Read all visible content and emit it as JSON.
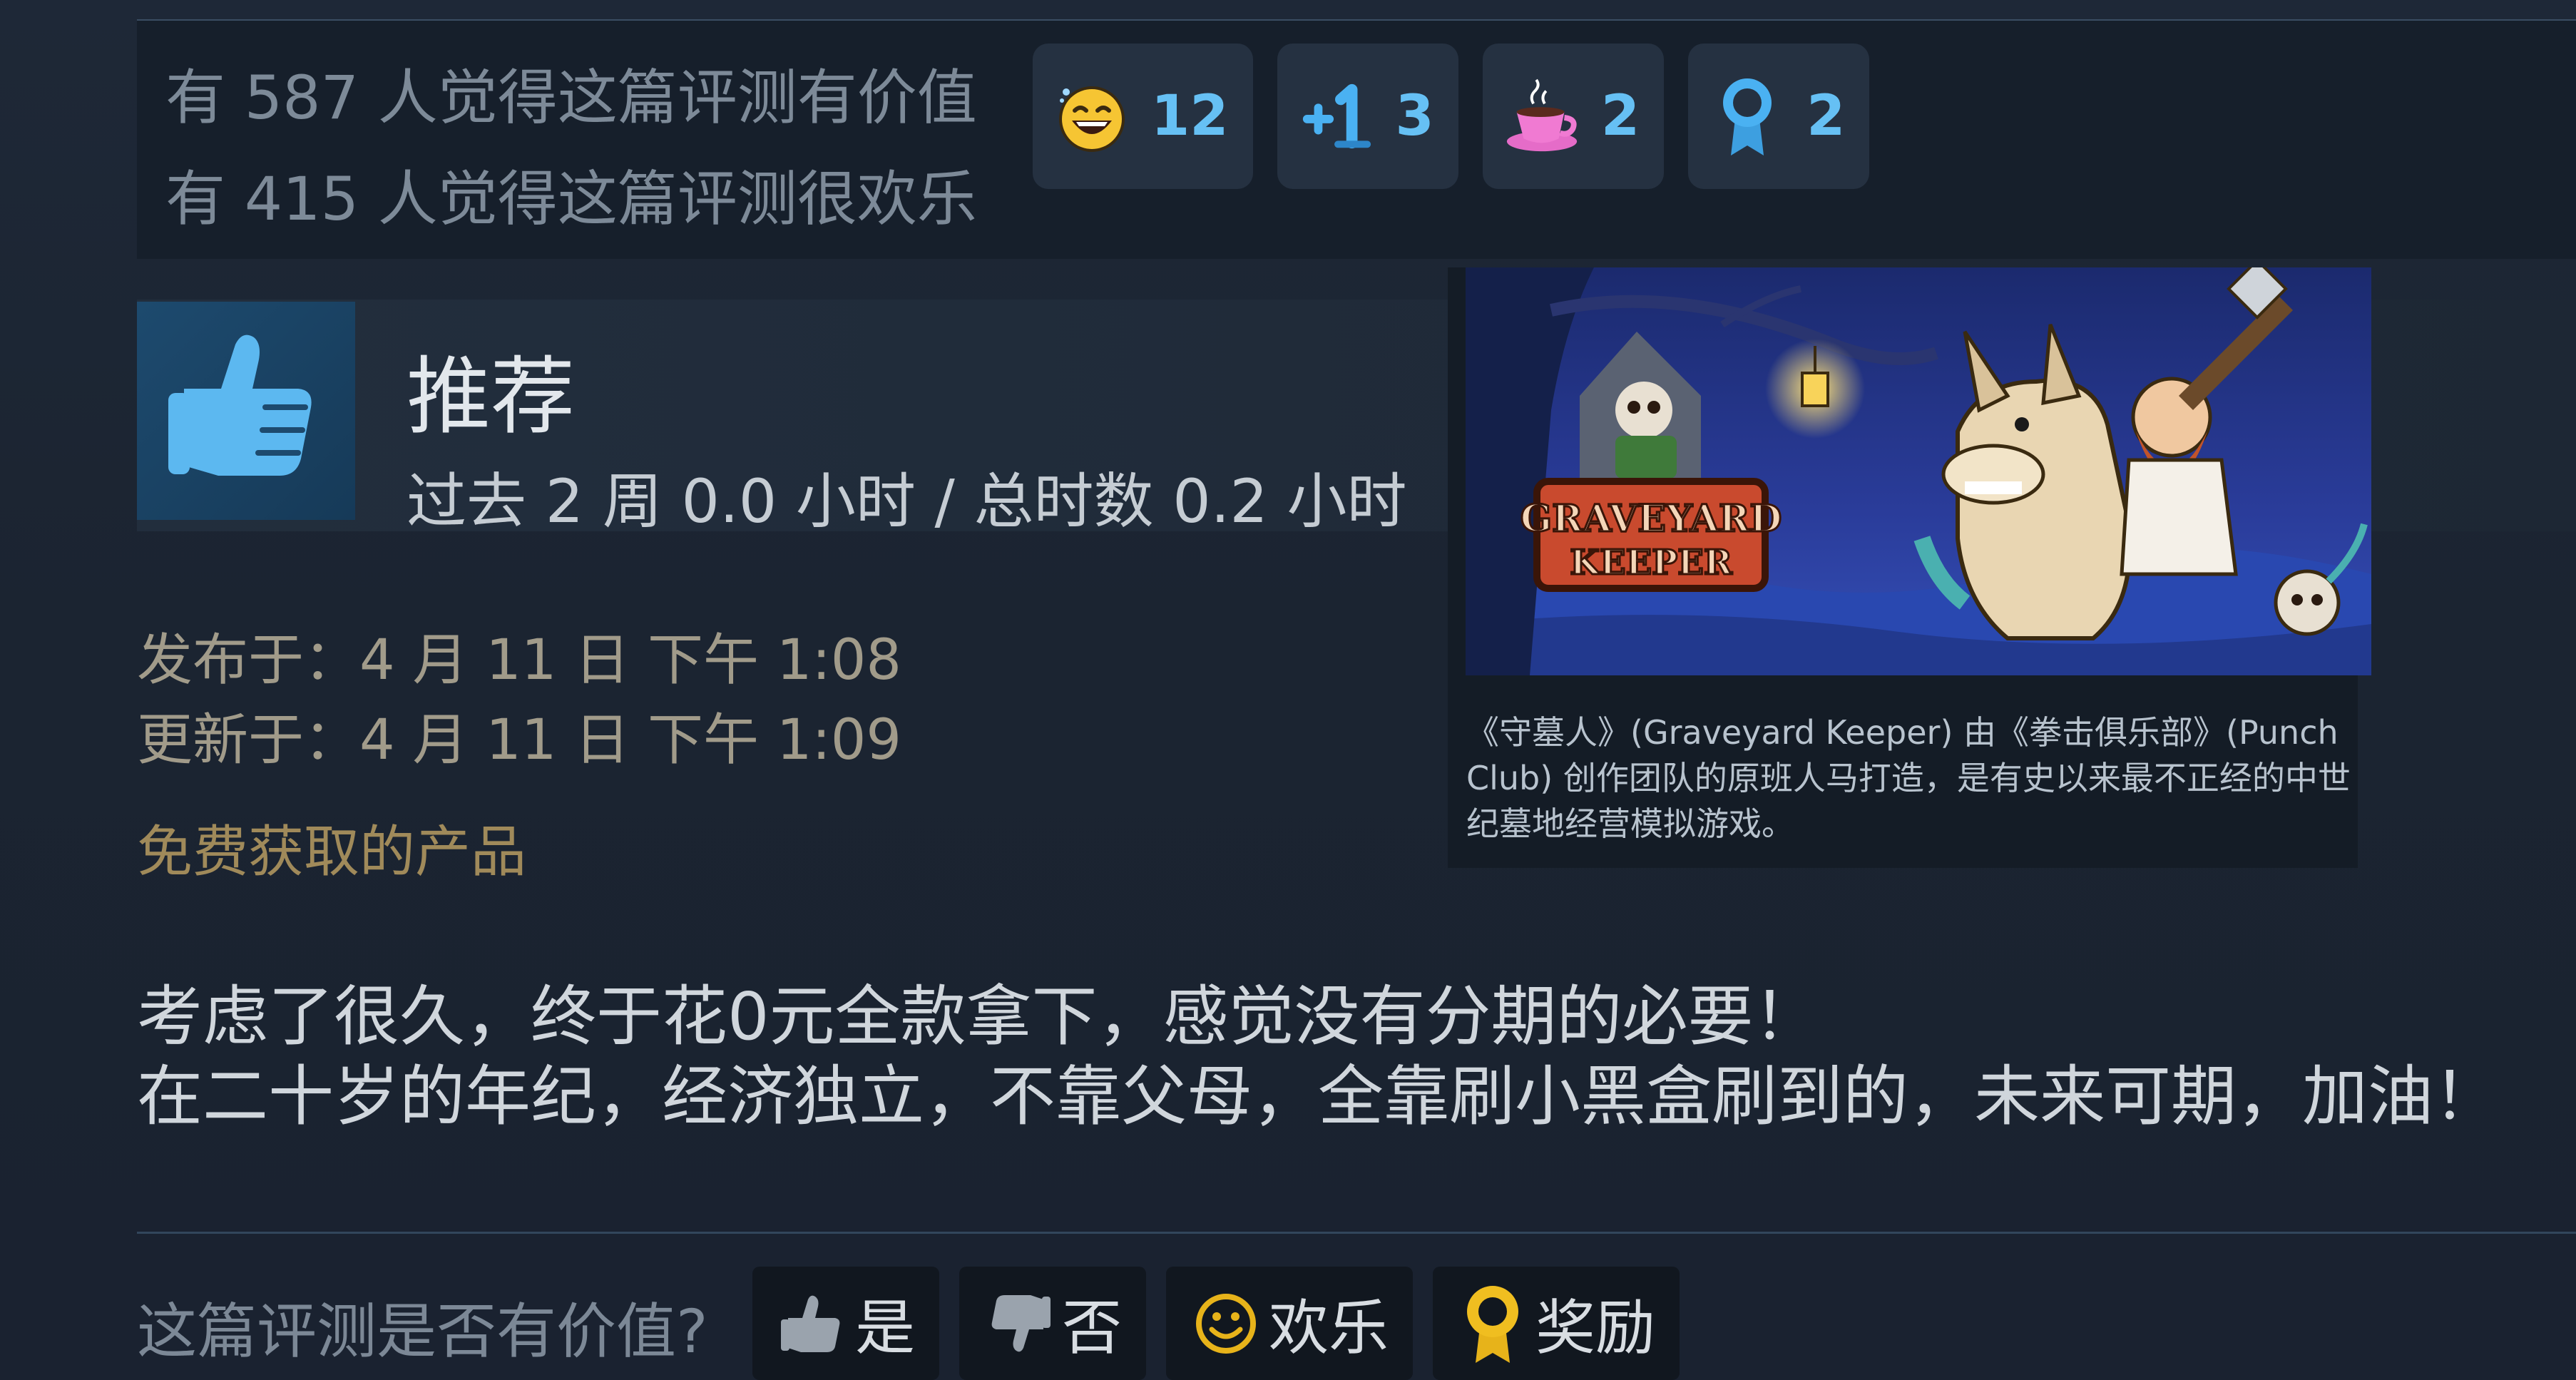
{
  "votes": {
    "helpful_line": "有 587 人觉得这篇评测有价值",
    "funny_line": "有 415 人觉得这篇评测很欢乐"
  },
  "awards": [
    {
      "icon": "laughing-face-icon",
      "count": "12"
    },
    {
      "icon": "plus-one-icon",
      "count": "3"
    },
    {
      "icon": "coffee-cup-icon",
      "count": "2"
    },
    {
      "icon": "ribbon-medal-icon",
      "count": "2"
    }
  ],
  "review": {
    "verdict": "推荐",
    "hours": "过去 2 周 0.0 小时 / 总时数 0.2 小时",
    "posted": "发布于：4 月 11 日 下午 1:08",
    "updated": "更新于：4 月 11 日 下午 1:09",
    "product_note": "免费获取的产品",
    "body_line1": "考虑了很久，终于花0元全款拿下，感觉没有分期的必要！",
    "body_line2": "在二十岁的年纪，经济独立，不靠父母，全靠刷小黑盒刷到的，未来可期，加油！"
  },
  "game_card": {
    "logo_line1": "GRAVEYARD",
    "logo_line2": "KEEPER",
    "description": "《守墓人》(Graveyard Keeper) 由《拳击俱乐部》(Punch Club) 创作团队的原班人马打造，是有史以来最不正经的中世纪墓地经营模拟游戏。"
  },
  "feedback": {
    "question": "这篇评测是否有价值?",
    "yes_label": "是",
    "no_label": "否",
    "funny_label": "欢乐",
    "award_label": "奖励"
  },
  "colors": {
    "accent_blue": "#66c0f4",
    "date_text": "#a19b8a",
    "product_note": "#a08a5a",
    "award_gold": "#e7b31a"
  }
}
